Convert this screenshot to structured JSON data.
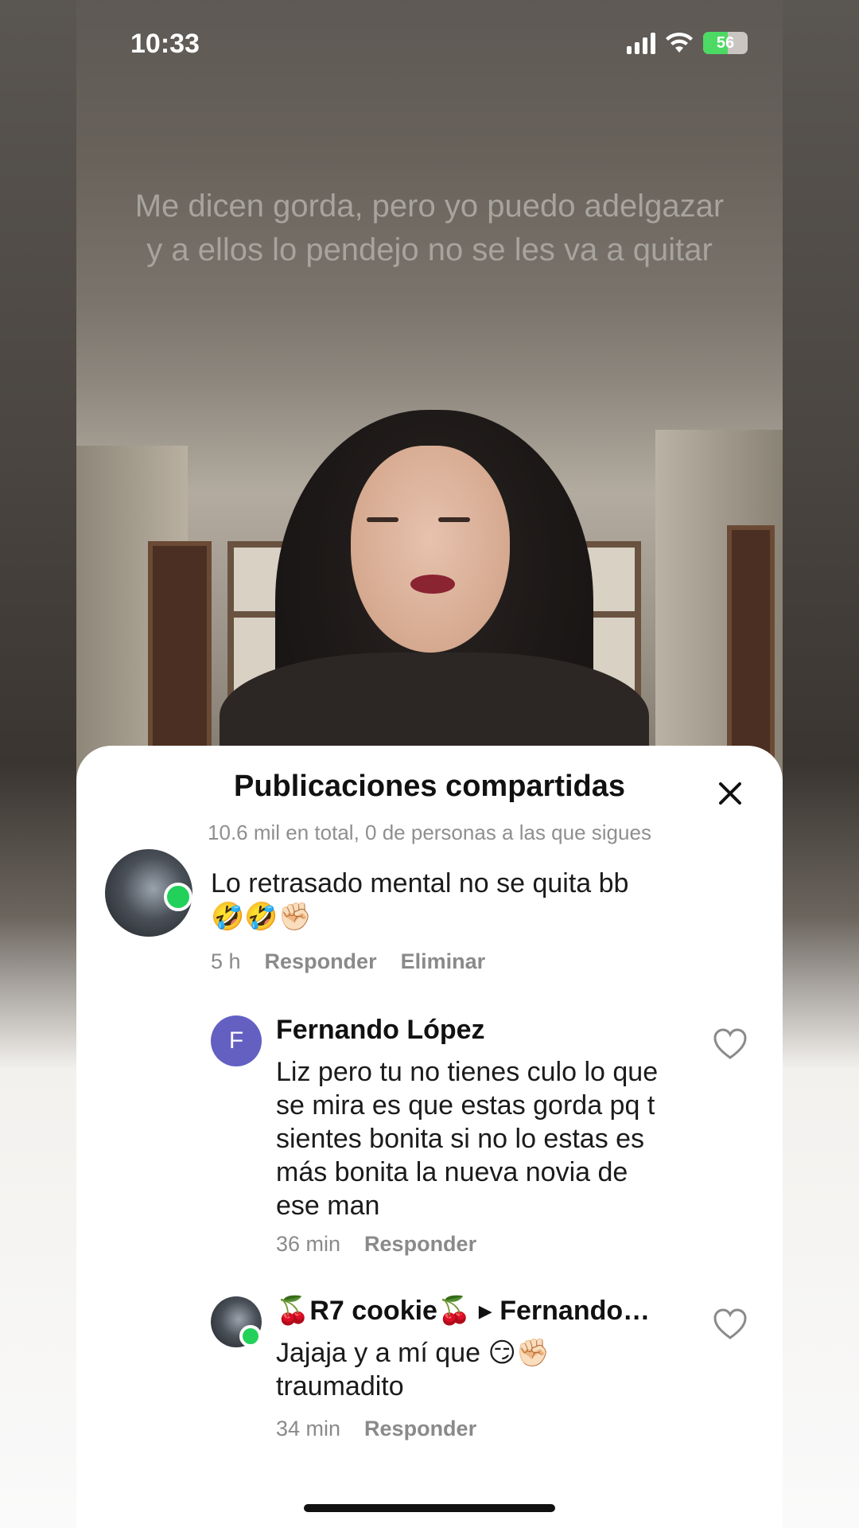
{
  "status_bar": {
    "time": "10:33",
    "battery": "56"
  },
  "video": {
    "caption": "Me dicen gorda, pero yo puedo adelgazar y a ellos lo pendejo no se les va a quitar"
  },
  "sheet": {
    "title": "Publicaciones compartidas",
    "subtitle": "10.6 mil en total, 0 de personas a las que sigues",
    "close_icon": "close-icon"
  },
  "comments": [
    {
      "text": "Lo retrasado mental no se quita bb 🤣🤣✊🏻",
      "time": "5 h",
      "reply_label": "Responder",
      "delete_label": "Eliminar"
    },
    {
      "avatar_letter": "F",
      "name": "Fernando López",
      "text": "Liz pero tu no tienes culo lo que se mira es que estas gorda pq t sientes bonita si no lo estas es más bonita la nueva novia de ese man",
      "time": "36 min",
      "reply_label": "Responder"
    },
    {
      "name": "🍒R7 cookie🍒 ▸ Fernando…",
      "text": "Jajaja y a mí que 😏✊🏻 traumadito",
      "time": "34 min",
      "reply_label": "Responder"
    }
  ],
  "colors": {
    "online": "#22d15a",
    "avatar_letter_bg": "#6360c2",
    "battery": "#4cd964"
  }
}
